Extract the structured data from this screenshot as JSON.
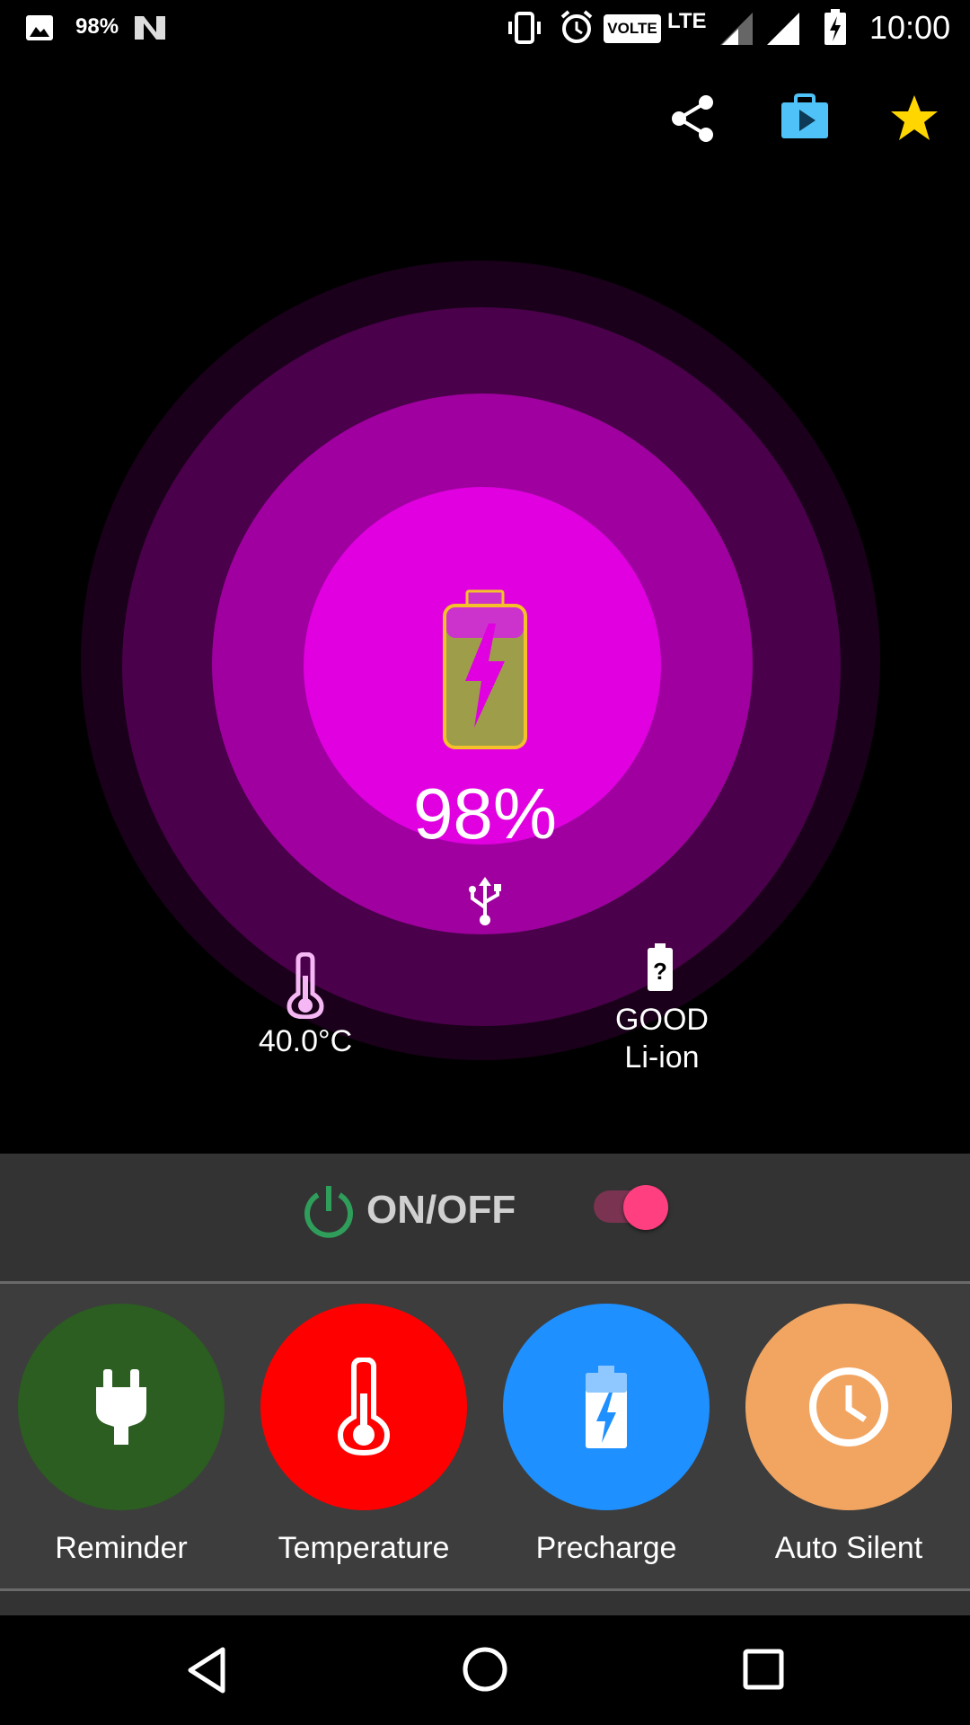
{
  "status_bar": {
    "battery_small": "98%",
    "volte": "VOLTE",
    "network": "LTE",
    "time": "10:00",
    "icons": [
      "image-icon",
      "n-icon",
      "vibrate-icon",
      "alarm-icon",
      "signal-icon",
      "signal-full-icon",
      "battery-charging-icon"
    ]
  },
  "toolbar": {
    "icons": [
      "share-icon",
      "play-store-icon",
      "star-icon"
    ],
    "star_color": "#FFD600",
    "store_color": "#4FC3F7"
  },
  "battery": {
    "percent": "98%",
    "level": 0.98,
    "source_icon": "usb-icon",
    "temperature": "40.0°C",
    "health": "GOOD",
    "type": "Li-ion",
    "ring_color": "#E000E0",
    "battery_fill": "#9E9E4A",
    "battery_outline": "#F4C12A"
  },
  "power": {
    "label": "ON/OFF",
    "enabled": true,
    "icon_color": "#2E9E5A",
    "toggle_color": "#FF3F7F"
  },
  "features": [
    {
      "label": "Reminder",
      "icon": "plug-icon",
      "color": "#2B5E20"
    },
    {
      "label": "Temperature",
      "icon": "thermometer-icon",
      "color": "#FF0000"
    },
    {
      "label": "Precharge",
      "icon": "battery-charge-icon",
      "color": "#1E90FF"
    },
    {
      "label": "Auto Silent",
      "icon": "clock-icon",
      "color": "#F2A561"
    }
  ],
  "nav": {
    "icons": [
      "back-icon",
      "home-icon",
      "recents-icon"
    ]
  }
}
